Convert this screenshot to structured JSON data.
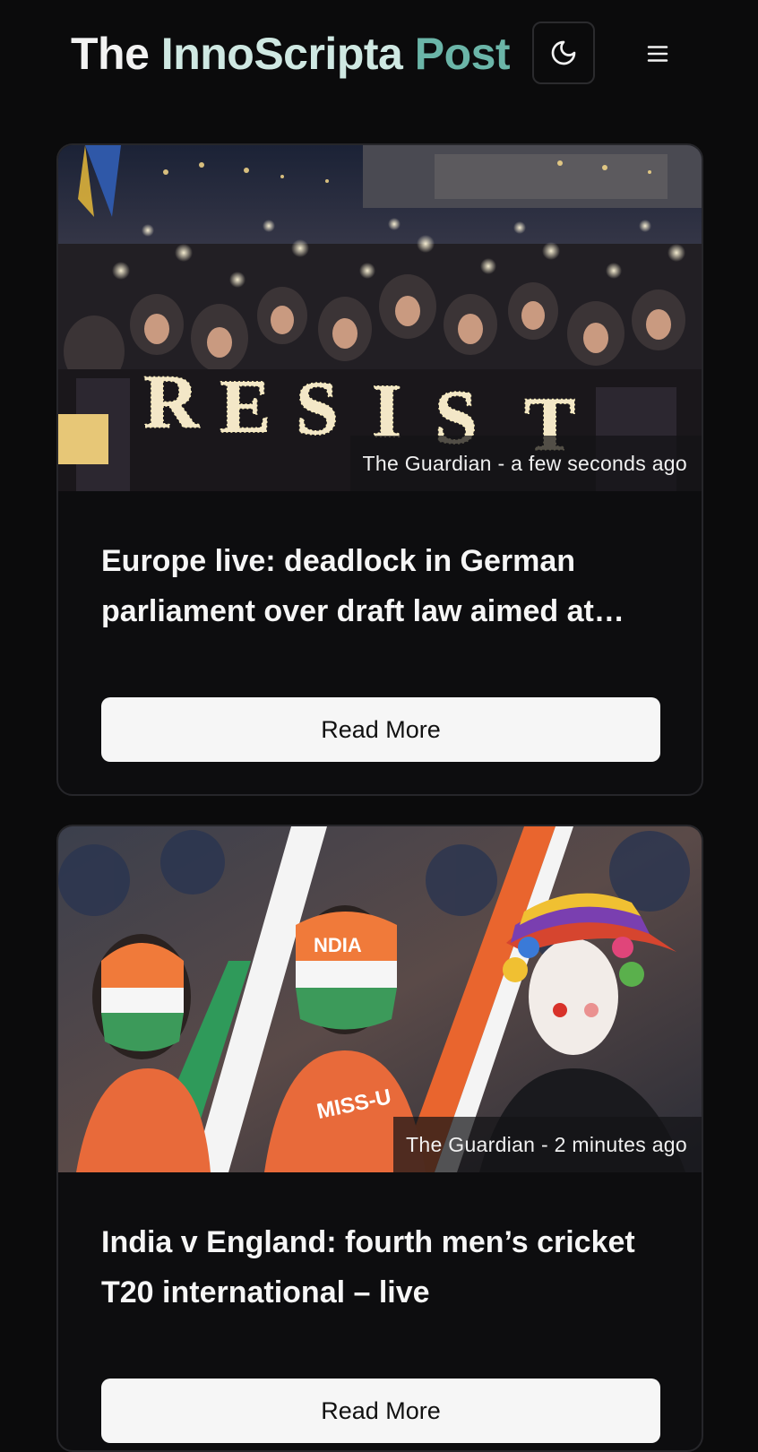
{
  "header": {
    "brand_part1": "The ",
    "brand_part2": "InnoScripta ",
    "brand_part3": "Post",
    "theme_toggle_icon": "moon-icon",
    "menu_icon": "hamburger-menu-icon"
  },
  "articles": [
    {
      "source_time": "The Guardian - a few seconds ago",
      "title": "Europe live: deadlock in German parliament over draft law aimed at…",
      "button_label": "Read More",
      "image_desc": "crowd protest resist lights"
    },
    {
      "source_time": "The Guardian - 2 minutes ago",
      "title": "India v England: fourth men’s cricket T20 international – live",
      "button_label": "Read More",
      "image_desc": "cricket fans face paint flag"
    }
  ],
  "colors": {
    "background": "#0b0b0c",
    "brand_light": "#cfe8e2",
    "brand_accent": "#6bb5a8",
    "button_bg": "#f6f6f6"
  }
}
